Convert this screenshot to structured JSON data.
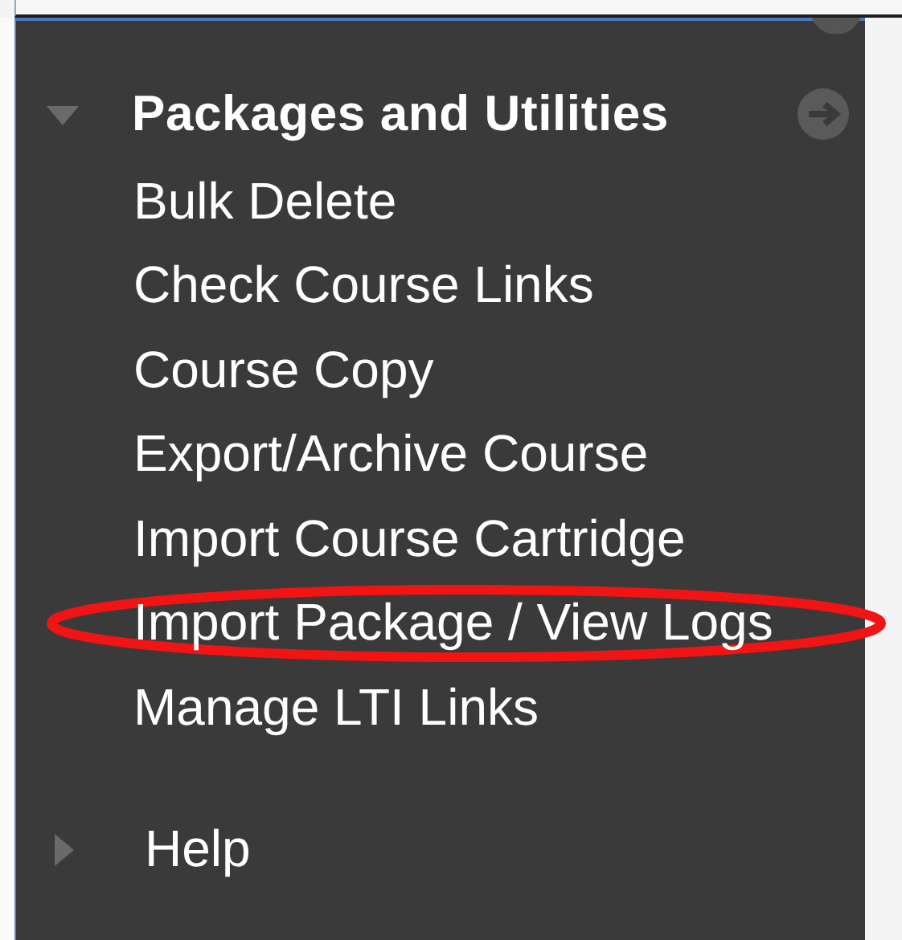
{
  "sections": [
    {
      "title": "Packages and Utilities",
      "expanded": true,
      "items": [
        {
          "label": "Bulk Delete",
          "circled": false
        },
        {
          "label": "Check Course Links",
          "circled": false
        },
        {
          "label": "Course Copy",
          "circled": false
        },
        {
          "label": "Export/Archive Course",
          "circled": false
        },
        {
          "label": "Import Course Cartridge",
          "circled": false
        },
        {
          "label": "Import Package / View Logs",
          "circled": true
        },
        {
          "label": "Manage LTI Links",
          "circled": false
        }
      ]
    },
    {
      "title": "Help",
      "expanded": false
    }
  ]
}
